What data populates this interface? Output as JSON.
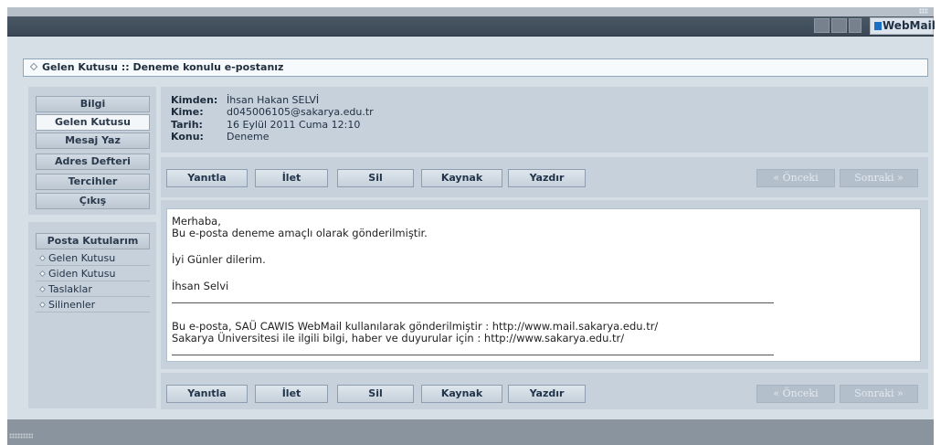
{
  "window": {
    "brand": "WebMail"
  },
  "header": {
    "breadcrumb": "Gelen Kutusu :: Deneme konulu e-postanız"
  },
  "sidebar": {
    "nav": [
      {
        "label": "Bilgi",
        "active": false
      },
      {
        "label": "Gelen Kutusu",
        "active": true
      },
      {
        "label": "Mesaj Yaz",
        "active": false
      },
      {
        "label": "Adres Defteri",
        "active": false
      },
      {
        "label": "Tercihler",
        "active": false
      },
      {
        "label": "Çıkış",
        "active": false
      }
    ],
    "folders_title": "Posta Kutularım",
    "folders": [
      "Gelen Kutusu",
      "Giden Kutusu",
      "Taslaklar",
      "Silinenler"
    ]
  },
  "message": {
    "from_label": "Kimden:",
    "from": "İhsan Hakan SELVİ",
    "to_label": "Kime:",
    "to": "d045006105@sakarya.edu.tr",
    "date_label": "Tarih:",
    "date": "16 Eylül 2011 Cuma 12:10",
    "subject_label": "Konu:",
    "subject": "Deneme",
    "body": {
      "greeting": "Merhaba,",
      "line1": "Bu e-posta deneme amaçlı olarak gönderilmiştir.",
      "line2": "İyi Günler dilerim.",
      "signature": "İhsan Selvi",
      "footer1": "Bu e-posta, SAÜ CAWIS WebMail kullanılarak gönderilmiştir : http://www.mail.sakarya.edu.tr/",
      "footer2": "Sakarya Üniversitesi ile ilgili bilgi, haber ve duyurular için : http://www.sakarya.edu.tr/"
    }
  },
  "actions": {
    "reply": "Yanıtla",
    "forward": "İlet",
    "delete": "Sil",
    "source": "Kaynak",
    "print": "Yazdır",
    "previous": "« Önceki",
    "next": "Sonraki »"
  }
}
